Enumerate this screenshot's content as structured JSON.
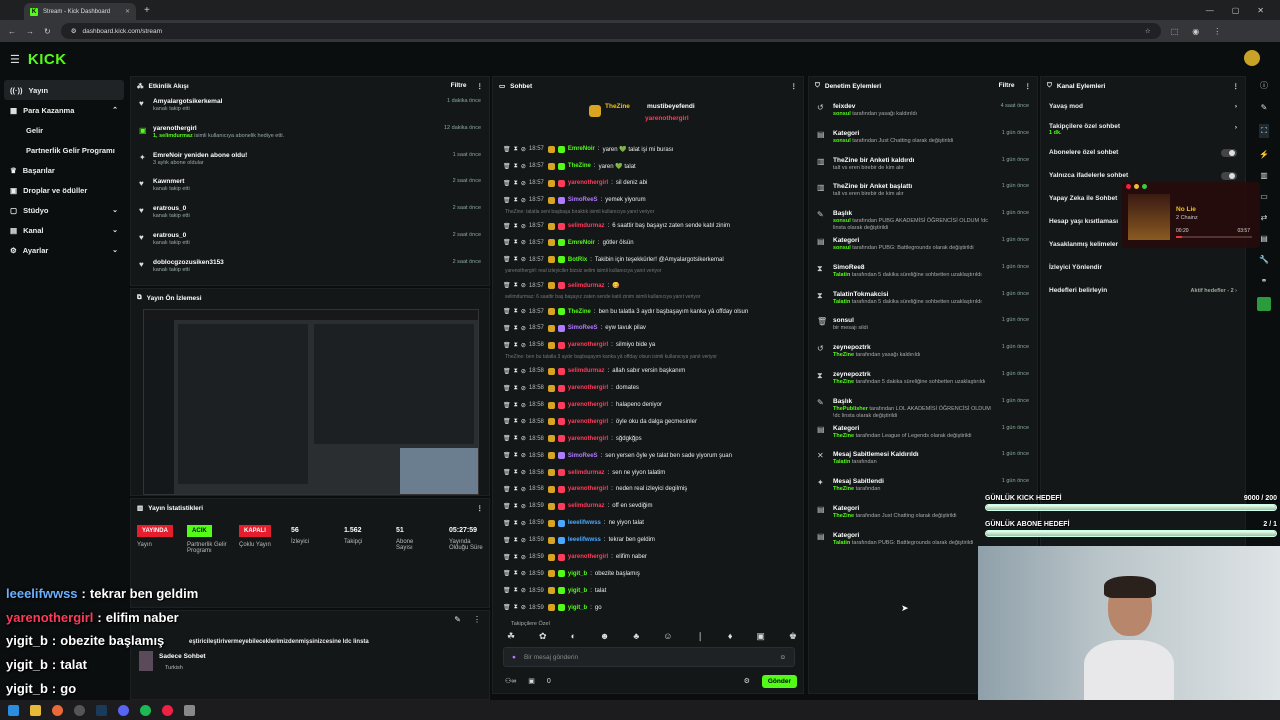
{
  "browser": {
    "tab_title": "Stream - Kick Dashboard",
    "url": "dashboard.kick.com/stream"
  },
  "app": {
    "logo": "KICK"
  },
  "sidebar": {
    "items": [
      {
        "label": "Yayın",
        "icon": "broadcast-icon"
      },
      {
        "label": "Para Kazanma",
        "icon": "money-icon"
      },
      {
        "label": "Gelir",
        "icon": ""
      },
      {
        "label": "Partnerlik Gelir Programı",
        "icon": ""
      },
      {
        "label": "Başarılar",
        "icon": "trophy-icon"
      },
      {
        "label": "Droplar ve ödüller",
        "icon": "gift-icon"
      },
      {
        "label": "Stüdyo",
        "icon": "studio-icon"
      },
      {
        "label": "Kanal",
        "icon": "channel-icon"
      },
      {
        "label": "Ayarlar",
        "icon": "gear-icon"
      }
    ]
  },
  "activity": {
    "title": "Etkinlik Akışı",
    "filter": "Filtre",
    "events": [
      {
        "name": "Amyalargotsikerkemal",
        "desc": "kanalı takip etti",
        "time": "1 dakika önce",
        "icon": "heart"
      },
      {
        "name": "yarenothergirl",
        "desc_user": "1, selimdurmaz",
        "desc": " isimli kullanıcıya abonelik hediye etti.",
        "time": "12 dakika önce",
        "icon": "gift"
      },
      {
        "name": "EmreNoir yeniden abone oldu!",
        "desc": "3 aylık abone oldular",
        "time": "1 saat önce",
        "icon": "star"
      },
      {
        "name": "Kawnmert",
        "desc": "kanalı takip etti",
        "time": "2 saat önce",
        "icon": "heart"
      },
      {
        "name": "eratrous_0",
        "desc": "kanalı takip etti",
        "time": "2 saat önce",
        "icon": "heart"
      },
      {
        "name": "eratrous_0",
        "desc": "kanalı takip etti",
        "time": "2 saat önce",
        "icon": "heart"
      },
      {
        "name": "doblocgzozusiken3153",
        "desc": "kanalı takip etti",
        "time": "2 saat önce",
        "icon": "heart"
      }
    ]
  },
  "preview": {
    "title": "Yayın Ön İzlemesi"
  },
  "stats": {
    "title": "Yayın İstatistikleri",
    "status": "YAYINDA",
    "partner_badge": "ACIK",
    "multi_badge": "KAPALI",
    "items": [
      {
        "value": "",
        "label": "Yayın"
      },
      {
        "value": "",
        "label": "Partnerlik Gelir Programı"
      },
      {
        "value": "",
        "label": "Çoklu Yayın"
      },
      {
        "value": "56",
        "label": "İzleyici"
      },
      {
        "value": "1.562",
        "label": "Takipçi"
      },
      {
        "value": "51",
        "label": "Abone Sayısı"
      },
      {
        "value": "05:27:59",
        "label": "Yayında Olduğu Süre"
      }
    ]
  },
  "chat_settings": {
    "rules": "eştiricileştirivermeyebileceklerimizdenmişsinizcesine ldc linsta",
    "mode": "Sadece Sohbet",
    "lang": "Turkish"
  },
  "chat": {
    "title": "Sohbet",
    "pinned": [
      {
        "name": "TheZine"
      },
      {
        "name": "mustibeyefendi"
      },
      {
        "name": "yarenothergirl"
      }
    ],
    "lines": [
      {
        "t": "18:57",
        "u": "EmreNoir",
        "c": "#53fc18",
        "m": "yaren 💚 talat işi mi burası"
      },
      {
        "t": "18:57",
        "u": "TheZine",
        "c": "#53fc18",
        "m": "yaren 💚 talat"
      },
      {
        "t": "18:57",
        "u": "yarenothergirl",
        "c": "#ff3b5c",
        "m": "sil deniz abi"
      },
      {
        "t": "18:57",
        "u": "SimoReeS",
        "c": "#b07bff",
        "m": "yemek yiyorum"
      },
      {
        "reply": "TheZine: talatla seni başbaşa bıraktık isimli kullanıcıya yanıt veriyor"
      },
      {
        "t": "18:57",
        "u": "selimdurmaz",
        "c": "#ff3b5c",
        "m": "6 saattir baş başayız zaten sende katıl zinim"
      },
      {
        "t": "18:57",
        "u": "EmreNoir",
        "c": "#53fc18",
        "m": "götler ölsün"
      },
      {
        "t": "18:57",
        "u": "BotRix",
        "c": "#53fc18",
        "m": "Takibin için teşekkürler! @Amyalargotsikerkemal"
      },
      {
        "reply": "yarenothergirl: real izleyiciler bizsiz selim isimli kullanıcıya yanıt veriyor"
      },
      {
        "t": "18:57",
        "u": "selimdurmaz",
        "c": "#ff3b5c",
        "m": "😋"
      },
      {
        "reply": "selimdurmaz: 6 saattir baş başayız zaten sende katıl zinim isimli kullanıcıya yanıt veriyor"
      },
      {
        "t": "18:57",
        "u": "TheZine",
        "c": "#53fc18",
        "m": "ben bu talatla 3 aydır başbaşayım kanka yâ offday olsun"
      },
      {
        "t": "18:57",
        "u": "SimoReeS",
        "c": "#b07bff",
        "m": "eyw tavuk pilav"
      },
      {
        "t": "18:58",
        "u": "yarenothergirl",
        "c": "#ff3b5c",
        "m": "silmiyo bide ya"
      },
      {
        "reply": "TheZine: ben bu talatla 3 aydır başbaşayım kanka yâ offday olsun isimli kullanıcıya yanıt veriyor"
      },
      {
        "t": "18:58",
        "u": "selimdurmaz",
        "c": "#ff3b5c",
        "m": "allah sabır versin başkanım"
      },
      {
        "t": "18:58",
        "u": "yarenothergirl",
        "c": "#ff3b5c",
        "m": "domates"
      },
      {
        "t": "18:58",
        "u": "yarenothergirl",
        "c": "#ff3b5c",
        "m": "halapeno deniyor"
      },
      {
        "t": "18:58",
        "u": "yarenothergirl",
        "c": "#ff3b5c",
        "m": "öyle oku da dalga gecmesinler"
      },
      {
        "t": "18:58",
        "u": "yarenothergirl",
        "c": "#ff3b5c",
        "m": "sğdgkğps"
      },
      {
        "t": "18:58",
        "u": "SimoReeS",
        "c": "#b07bff",
        "m": "sen yersen öyle ye talat ben sade yiyorum şuan"
      },
      {
        "t": "18:58",
        "u": "selimdurmaz",
        "c": "#ff3b5c",
        "m": "sen ne yiyon talatim"
      },
      {
        "t": "18:58",
        "u": "yarenothergirl",
        "c": "#ff3b5c",
        "m": "neden real izleyici degilmiş"
      },
      {
        "t": "18:59",
        "u": "selimdurmaz",
        "c": "#ff3b5c",
        "m": "off en sevdiğim"
      },
      {
        "t": "18:59",
        "u": "leeelifwwss",
        "c": "#4aa8ff",
        "m": "ne yiyon talat"
      },
      {
        "t": "18:59",
        "u": "leeelifwwss",
        "c": "#4aa8ff",
        "m": "tekrar ben geldim"
      },
      {
        "t": "18:59",
        "u": "yarenothergirl",
        "c": "#ff3b5c",
        "m": "elifim naber"
      },
      {
        "t": "18:59",
        "u": "yigit_b",
        "c": "#53fc18",
        "m": "obezite başlamış"
      },
      {
        "t": "18:59",
        "u": "yigit_b",
        "c": "#53fc18",
        "m": "talat"
      },
      {
        "t": "18:59",
        "u": "yigit_b",
        "c": "#53fc18",
        "m": "go"
      }
    ],
    "followers_only": "Takipçilere Özel",
    "input_placeholder": "Bir mesaj gönderin",
    "count": "0",
    "send": "Gönder"
  },
  "modlog": {
    "title": "Denetim Eylemleri",
    "filter": "Filtre",
    "items": [
      {
        "icon": "↺",
        "t1": "feixdev",
        "t2b": "sonsul",
        "t2": " tarafından yasağı kaldırıldı",
        "time": "4 saat önce"
      },
      {
        "icon": "▤",
        "t1": "Kategori",
        "t2b": "sonsul",
        "t2": " tarafından Just Chatting olarak değiştirildi",
        "time": "1 gün önce"
      },
      {
        "icon": "▥",
        "t1": "TheZine bir Anketi kaldırdı",
        "t2b": "",
        "t2": "talt vs eren birebir de kim alır",
        "time": "1 gün önce"
      },
      {
        "icon": "▥",
        "t1": "TheZine bir Anket başlattı",
        "t2b": "",
        "t2": "talt vs eren birebir de kim alır",
        "time": "1 gün önce"
      },
      {
        "icon": "✎",
        "t1": "Başlık",
        "t2b": "sonsul",
        "t2": " tarafından PUBG AKADEMİSİ ÖĞRENCİSİ OLDUM !dc linsta olarak değiştirildi",
        "time": "1 gün önce"
      },
      {
        "icon": "▤",
        "t1": "Kategori",
        "t2b": "sonsul",
        "t2": " tarafından PUBG: Battlegrounds olarak değiştirildi",
        "time": "1 gün önce"
      },
      {
        "icon": "⧗",
        "t1": "SimoRee8",
        "t2b": "Talatin",
        "t2": " tarafından 5 dakika süreliğine sohbetten uzaklaştırıldı",
        "time": "1 gün önce"
      },
      {
        "icon": "⧗",
        "t1": "TalatinTokmakcisi",
        "t2b": "Talatin",
        "t2": " tarafından 5 dakika süreliğine sohbetten uzaklaştırıldı",
        "time": "1 gün önce"
      },
      {
        "icon": "🗑",
        "t1": "sonsul",
        "t2b": "",
        "t2": "bir mesajı sildi",
        "time": "1 gün önce"
      },
      {
        "icon": "↺",
        "t1": "zeynepoztrk",
        "t2b": "TheZine",
        "t2": " tarafından yasağı kaldırıldı",
        "time": "1 gün önce"
      },
      {
        "icon": "⧗",
        "t1": "zeynepoztrk",
        "t2b": "TheZine",
        "t2": " tarafından 5 dakika süreliğine sohbetten uzaklaştırıldı",
        "time": "1 gün önce"
      },
      {
        "icon": "✎",
        "t1": "Başlık",
        "t2b": "ThePublisher",
        "t2": " tarafından LOL AKADEMİSİ ÖĞRENCİSİ OLDUM !dc linsta olarak değiştirildi",
        "time": "1 gün önce"
      },
      {
        "icon": "▤",
        "t1": "Kategori",
        "t2b": "TheZine",
        "t2": " tarafından League of Legends olarak değiştirildi",
        "time": "1 gün önce"
      },
      {
        "icon": "✕",
        "t1": "Mesaj Sabitlemesi Kaldırıldı",
        "t2b": "Talatin",
        "t2": " tarafından",
        "time": "1 gün önce"
      },
      {
        "icon": "✦",
        "t1": "Mesaj Sabitlendi",
        "t2b": "TheZine",
        "t2": " tarafından",
        "time": "1 gün önce"
      },
      {
        "icon": "▤",
        "t1": "Kategori",
        "t2b": "TheZine",
        "t2": " tarafından Just Chatting olarak değiştirildi",
        "time": "1 gün önce"
      },
      {
        "icon": "▤",
        "t1": "Kategori",
        "t2b": "Talatin",
        "t2": " tarafından PUBG: Battlegrounds olarak değiştirildi",
        "time": "1 gün önce"
      }
    ]
  },
  "channel_actions": {
    "title": "Kanal Eylemleri",
    "items": [
      {
        "label": "Yavaş mod",
        "right": "›"
      },
      {
        "label": "Takipçilere özel sohbet",
        "sub": "1 dk.",
        "right": "›"
      },
      {
        "label": "Abonelere özel sohbet",
        "right": "toggle"
      },
      {
        "label": "Yalnızca ifadelerle sohbet",
        "right": "toggle"
      },
      {
        "label": "Yapay Zeka ile Sohbet",
        "right": ""
      },
      {
        "label": "Hesap yaşı kısıtlaması",
        "right": ""
      },
      {
        "label": "Yasaklanmış kelimeler",
        "right": ""
      },
      {
        "label": "İzleyici Yönlendir",
        "right": ""
      },
      {
        "label": "Hedefleri belirleyin",
        "right": "Aktif hedefler - 2 ›"
      }
    ]
  },
  "music": {
    "title": "No Lie",
    "artist": "2 Chainz",
    "elapsed": "00:20",
    "total": "03:57"
  },
  "goals": [
    {
      "label": "GÜNLÜK KICK HEDEFİ",
      "value": "9000 / 200",
      "progress": 1.0
    },
    {
      "label": "GÜNLÜK ABONE HEDEFİ",
      "value": "2 / 1",
      "progress": 1.0
    }
  ],
  "overlay_chat": [
    {
      "user": "leeelifwwss",
      "msg": "tekrar ben geldim",
      "color": "#6ab0ff"
    },
    {
      "user": "yarenothergirl",
      "msg": "elifim naber",
      "color": "#ff3b5c"
    },
    {
      "user": "yigit_b",
      "msg": "obezite başlamış",
      "color": "#ffffff"
    },
    {
      "user": "yigit_b",
      "msg": "talat",
      "color": "#ffffff"
    },
    {
      "user": "yigit_b",
      "msg": "go",
      "color": "#ffffff"
    }
  ],
  "colors": {
    "accent": "#53fc18",
    "live": "#e61d2c"
  }
}
